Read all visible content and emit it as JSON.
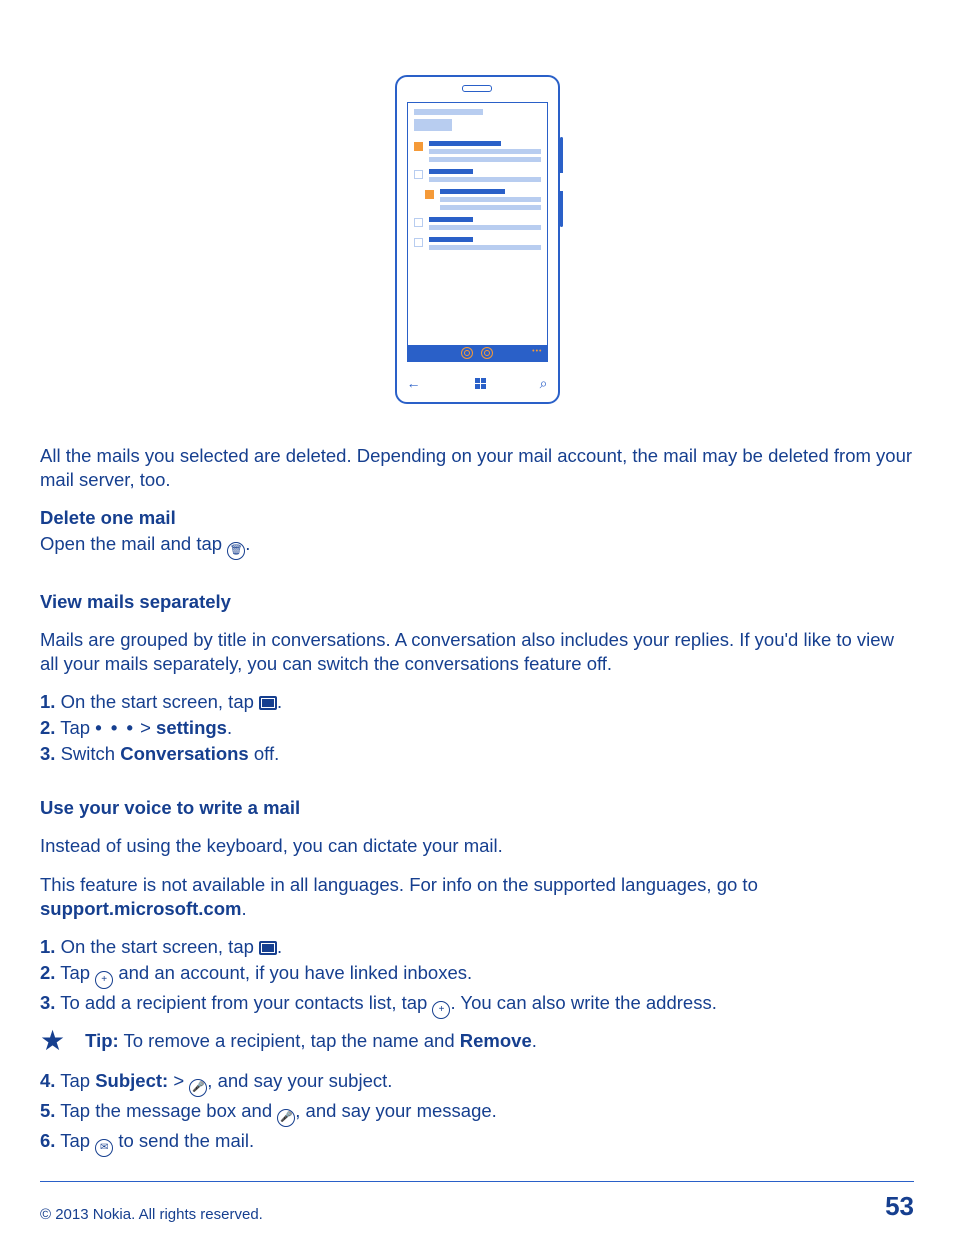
{
  "intro_text": "All the mails you selected are deleted. Depending on your mail account, the mail may be deleted from your mail server, too.",
  "delete_one": {
    "heading": "Delete one mail",
    "line_pre": "Open the mail and tap ",
    "line_post": "."
  },
  "view_sep": {
    "heading": "View mails separately",
    "intro": "Mails are grouped by title in conversations. A conversation also includes your replies. If you'd like to view all your mails separately, you can switch the conversations feature off.",
    "s1_pre": "1.",
    "s1_txt": " On the start screen, tap ",
    "s1_post": ".",
    "s2_pre": "2.",
    "s2_a": " Tap  ",
    "s2_dots": "• • •",
    "s2_b": "  > ",
    "s2_settings": "settings",
    "s2_post": ".",
    "s3_pre": "3.",
    "s3_a": " Switch ",
    "s3_conv": "Conversations",
    "s3_b": " off."
  },
  "voice": {
    "heading": "Use your voice to write a mail",
    "p1": "Instead of using the keyboard, you can dictate your mail.",
    "p2a": "This feature is not available in all languages. For info on the supported languages, go to ",
    "p2b": "support.microsoft.com",
    "p2c": ".",
    "s1_pre": "1.",
    "s1_txt": " On the start screen, tap ",
    "s1_post": ".",
    "s2_pre": "2.",
    "s2_a": " Tap ",
    "s2_b": " and an account, if you have linked inboxes.",
    "s3_pre": "3.",
    "s3_a": " To add a recipient from your contacts list, tap ",
    "s3_b": ". You can also write the address.",
    "tip_label": "Tip:",
    "tip_a": " To remove a recipient, tap the name and ",
    "tip_remove": "Remove",
    "tip_b": ".",
    "s4_pre": "4.",
    "s4_a": " Tap ",
    "s4_subj": "Subject:",
    "s4_b": " > ",
    "s4_c": ", and say your subject.",
    "s5_pre": "5.",
    "s5_a": " Tap the message box and ",
    "s5_b": ", and say your message.",
    "s6_pre": "6.",
    "s6_a": " Tap ",
    "s6_b": " to send the mail."
  },
  "footer": {
    "copyright": "© 2013 Nokia. All rights reserved.",
    "page": "53"
  }
}
